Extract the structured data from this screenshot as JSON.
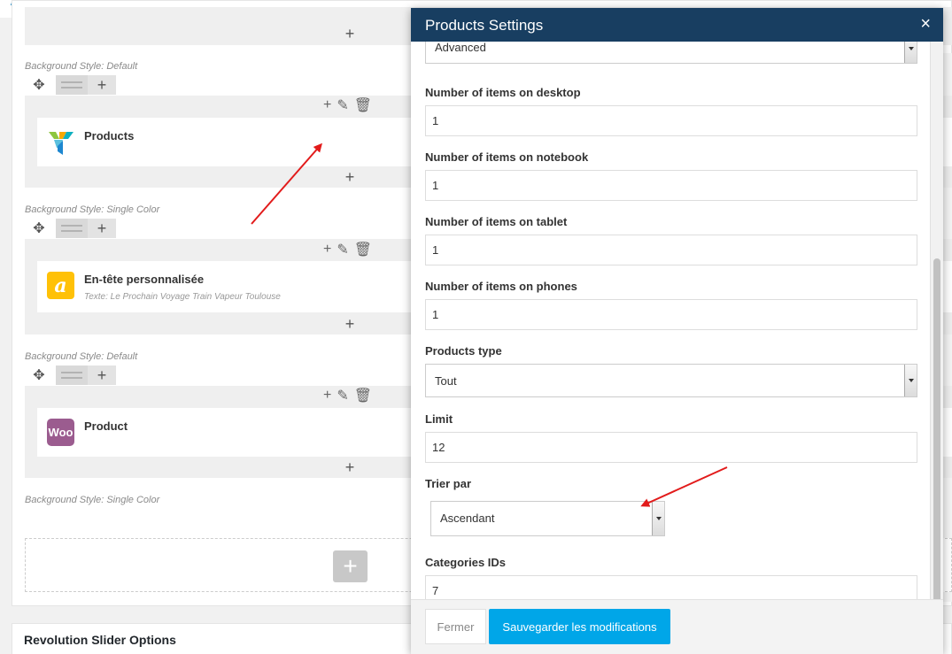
{
  "builder": {
    "rows": [
      {
        "background_label": "Background Style: Default",
        "element": {
          "title": "Products",
          "subtitle": "",
          "icon": "visual-composer-icon"
        }
      },
      {
        "background_label": "Background Style: Single Color",
        "element": {
          "title": "En-tête personnalisée",
          "subtitle": "Texte: Le Prochain Voyage Train Vapeur Toulouse",
          "icon": "custom-heading-icon",
          "icon_text": "a"
        }
      },
      {
        "background_label": "Background Style: Default",
        "element": {
          "title": "Product",
          "subtitle": "",
          "icon": "woocommerce-icon",
          "icon_text": "Woo"
        }
      },
      {
        "background_label": "Background Style: Single Color"
      }
    ],
    "icons": {
      "move": "✥",
      "add": "+",
      "edit": "✎",
      "delete": "🗑"
    }
  },
  "revolution": {
    "title": "Revolution Slider Options"
  },
  "modal": {
    "title": "Products Settings",
    "close_symbol": "×",
    "top_select_value": "Advanced",
    "fields": {
      "desktop": {
        "label": "Number of items on desktop",
        "value": "1"
      },
      "notebook": {
        "label": "Number of items on notebook",
        "value": "1"
      },
      "tablet": {
        "label": "Number of items on tablet",
        "value": "1"
      },
      "phones": {
        "label": "Number of items on phones",
        "value": "1"
      },
      "products_type": {
        "label": "Products type",
        "value": "Tout"
      },
      "limit": {
        "label": "Limit",
        "value": "12"
      },
      "sort": {
        "label": "Trier par",
        "value": "Ascendant"
      },
      "categories": {
        "label": "Categories IDs",
        "value": "7"
      }
    },
    "buttons": {
      "close": "Fermer",
      "save": "Sauvegarder les modifications"
    }
  },
  "colors": {
    "header": "#183e61",
    "save_button": "#00a6e8",
    "arrow": "#e21b1b",
    "woo": "#9b5c8f",
    "heading_icon": "#ffc107"
  }
}
